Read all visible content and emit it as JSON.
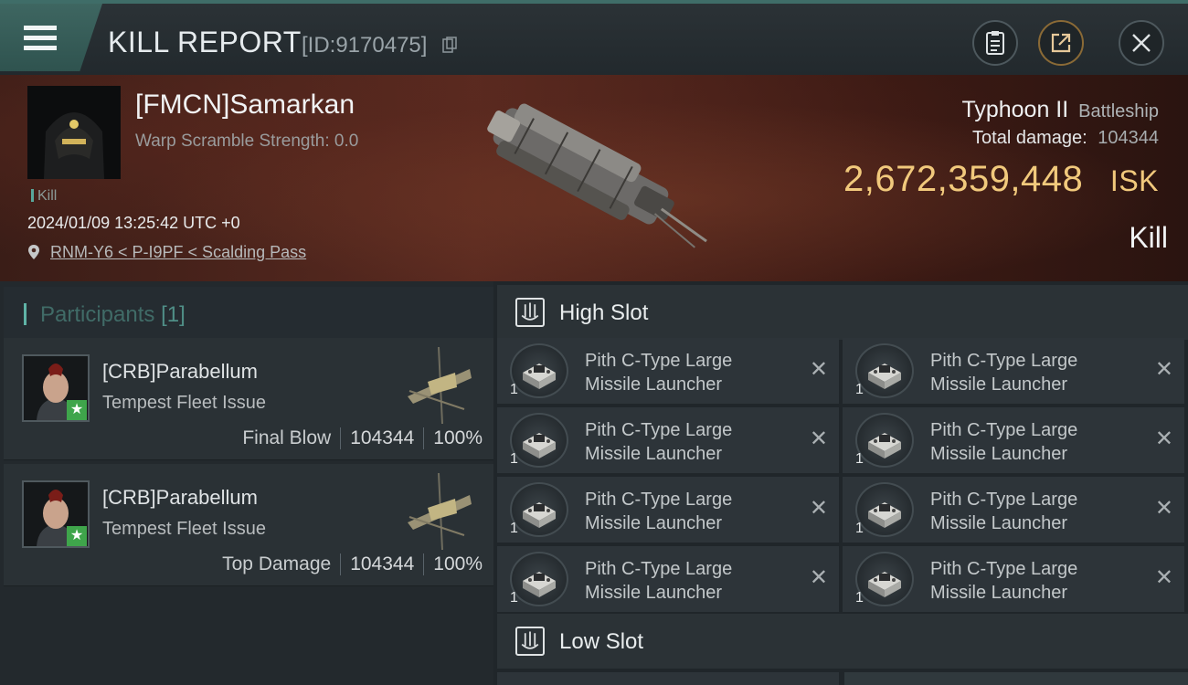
{
  "header": {
    "title": "KILL REPORT",
    "report_id": "[ID:9170475]",
    "accent": "#3f6d68"
  },
  "victim": {
    "name": "[FMCN]Samarkan",
    "warp_scramble": "Warp Scramble Strength: 0.0",
    "tag": "Kill",
    "datetime": "2024/01/09 13:25:42 UTC +0",
    "location": "RNM-Y6 < P-I9PF < Scalding Pass",
    "ship_name": "Typhoon II",
    "ship_class": "Battleship",
    "total_damage_label": "Total damage:",
    "total_damage": "104344",
    "isk_value": "2,672,359,448",
    "isk_unit": "ISK",
    "result": "Kill",
    "isk_color": "#f1c97c"
  },
  "participants": {
    "label": "Participants",
    "count": "[1]",
    "rows": [
      {
        "name": "[CRB]Parabellum",
        "ship": "Tempest Fleet Issue",
        "role": "Final Blow",
        "damage": "104344",
        "percent": "100%"
      },
      {
        "name": "[CRB]Parabellum",
        "ship": "Tempest Fleet Issue",
        "role": "Top Damage",
        "damage": "104344",
        "percent": "100%"
      }
    ]
  },
  "slots": {
    "high": {
      "title": "High Slot",
      "modules": [
        {
          "line1": "Pith C-Type Large",
          "line2": "Missile Launcher",
          "qty": "1"
        },
        {
          "line1": "Pith C-Type Large",
          "line2": "Missile Launcher",
          "qty": "1"
        },
        {
          "line1": "Pith C-Type Large",
          "line2": "Missile Launcher",
          "qty": "1"
        },
        {
          "line1": "Pith C-Type Large",
          "line2": "Missile Launcher",
          "qty": "1"
        },
        {
          "line1": "Pith C-Type Large",
          "line2": "Missile Launcher",
          "qty": "1"
        },
        {
          "line1": "Pith C-Type Large",
          "line2": "Missile Launcher",
          "qty": "1"
        },
        {
          "line1": "Pith C-Type Large",
          "line2": "Missile Launcher",
          "qty": "1"
        },
        {
          "line1": "Pith C-Type Large",
          "line2": "Missile Launcher",
          "qty": "1"
        }
      ]
    },
    "low": {
      "title": "Low Slot"
    }
  },
  "icons": {
    "menu": "hamburger-menu-icon",
    "copy": "copy-icon",
    "clipboard": "clipboard-icon",
    "share": "share-icon",
    "close": "close-icon",
    "location": "location-pin-icon",
    "slot": "slot-icon",
    "remove": "x-icon"
  }
}
